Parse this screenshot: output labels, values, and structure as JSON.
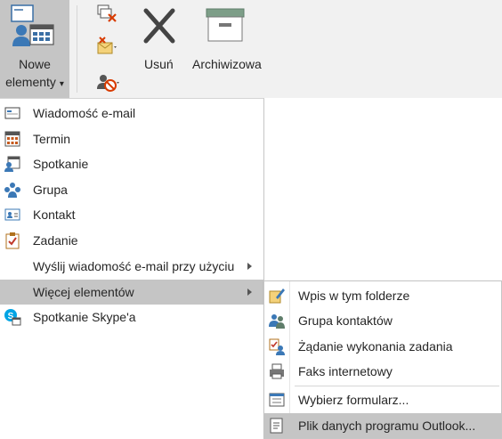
{
  "ribbon": {
    "new_items": {
      "line1": "Nowe",
      "line2": "elementy",
      "caret": "▾",
      "icon": "new-items-icon"
    },
    "delete": {
      "label": "Usuń",
      "icon": "close-icon"
    },
    "archive": {
      "label": "Archiwizowa",
      "icon": "archive-icon"
    },
    "small_icons": [
      "clean-up-icon",
      "junk-icon",
      "block-icon"
    ]
  },
  "new_menu": {
    "items": [
      {
        "label": "Wiadomość e-mail",
        "icon": "email-icon"
      },
      {
        "label": "Termin",
        "icon": "calendar-icon"
      },
      {
        "label": "Spotkanie",
        "icon": "meeting-icon"
      },
      {
        "label": "Grupa",
        "icon": "group-icon"
      },
      {
        "label": "Kontakt",
        "icon": "contact-icon"
      },
      {
        "label": "Zadanie",
        "icon": "task-icon"
      },
      {
        "label": "Wyślij wiadomość e-mail przy użyciu",
        "icon": ""
      },
      {
        "label": "Więcej elementów",
        "icon": ""
      },
      {
        "label": "Spotkanie Skype'a",
        "icon": "skype-icon"
      }
    ]
  },
  "more_menu": {
    "items": [
      {
        "label": "Wpis w tym folderze",
        "icon": "post-icon"
      },
      {
        "label": "Grupa kontaktów",
        "icon": "contact-group-icon"
      },
      {
        "label": "Żądanie wykonania zadania",
        "icon": "task-request-icon"
      },
      {
        "label": "Faks internetowy",
        "icon": "fax-icon"
      },
      {
        "label": "Wybierz formularz...",
        "icon": "form-icon"
      },
      {
        "label": "Plik danych programu Outlook...",
        "icon": "data-file-icon"
      }
    ]
  }
}
